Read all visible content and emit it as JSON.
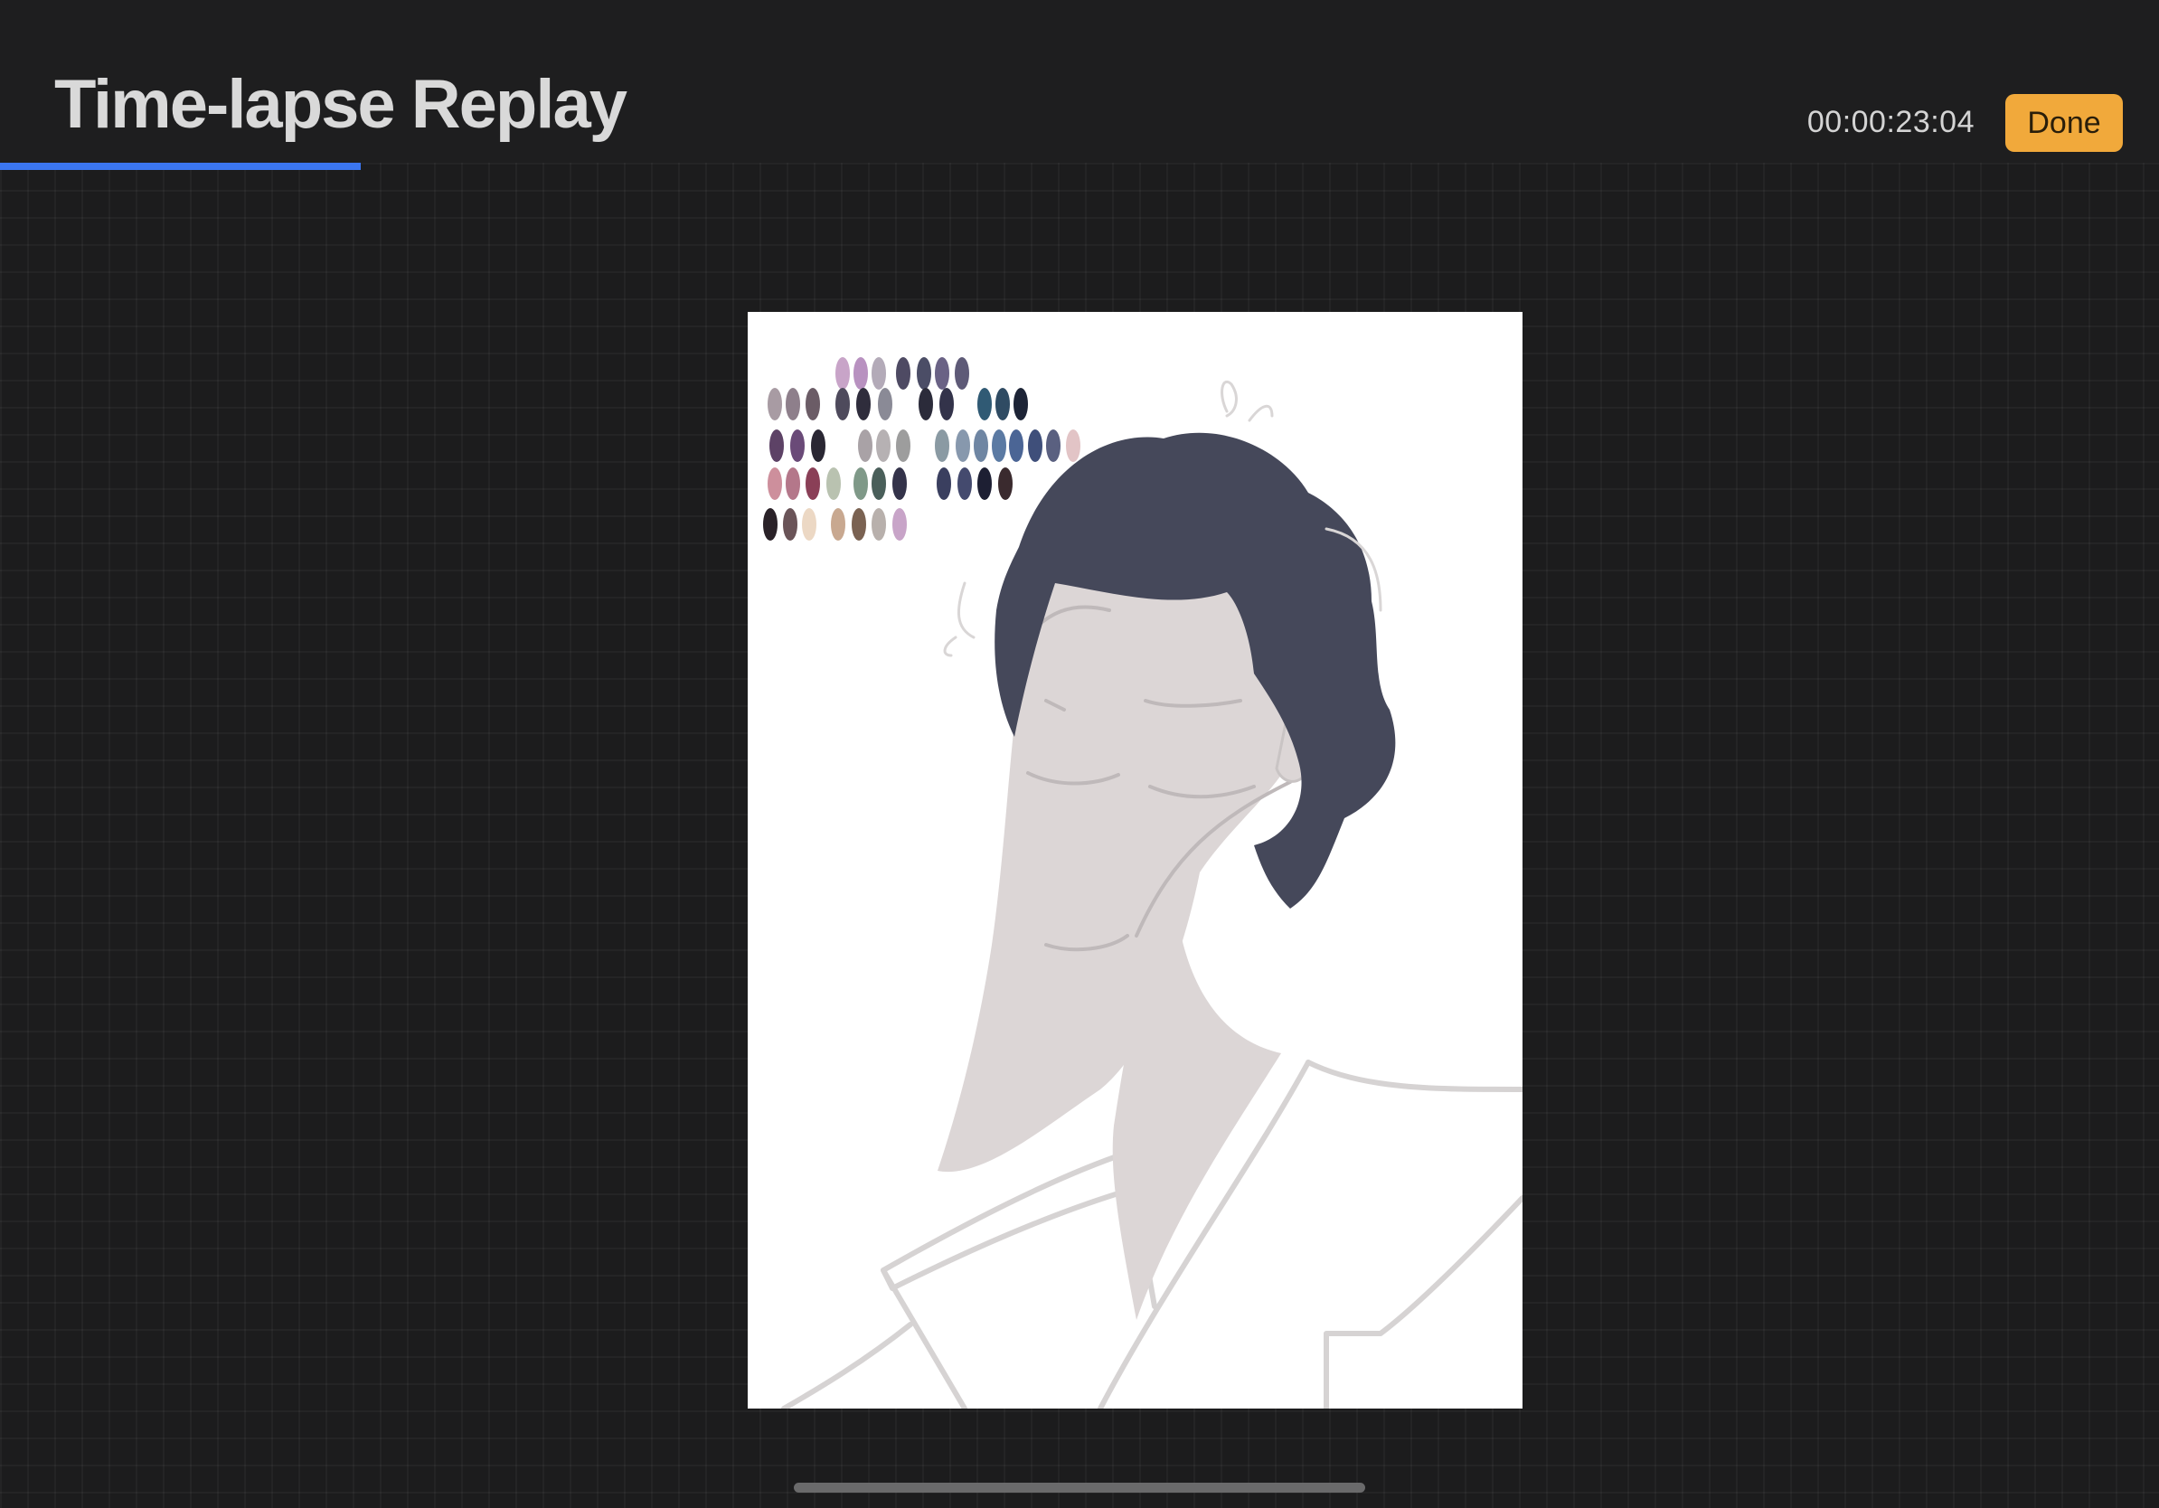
{
  "header": {
    "title": "Time-lapse Replay",
    "timecode": "00:00:23:04",
    "done_label": "Done"
  },
  "playback": {
    "progress_fraction": 0.167
  },
  "colors": {
    "accent_button": "#f1a93b",
    "progress": "#3b76f0",
    "hair": "#45485a",
    "skin": "#dcd6d6",
    "sketch_line": "#cfcccc"
  },
  "palette_swatches": [
    "#c8a4c8",
    "#b891c0",
    "#b3aab8",
    "#4e4a63",
    "#4b4d66",
    "#6a6285",
    "#5e5a77",
    "#a89ba3",
    "#8e7f8b",
    "#6b5c66",
    "#4e4a5c",
    "#2f2d3c",
    "#8a8a96",
    "#2b2b3a",
    "#33334a",
    "#305a74",
    "#2f4b63",
    "#1d2436",
    "#5d4266",
    "#6a4a78",
    "#2a2733",
    "#a9a2a6",
    "#b6b1b3",
    "#9d9d9d",
    "#8a9aa3",
    "#8798ad",
    "#6f86a3",
    "#5b7aa3",
    "#4b6595",
    "#3f4f7a",
    "#5a6080",
    "#e2c4c6",
    "#cd8f9c",
    "#b4778a",
    "#8a3f57",
    "#b9c2b0",
    "#7f9988",
    "#4a5f5a",
    "#34334a",
    "#3a3f5f",
    "#444a6e",
    "#1d1f33",
    "#3a2a2e",
    "#2a2228",
    "#6a5458",
    "#ecd8c4",
    "#c8a890",
    "#7a6252",
    "#b8b0ac"
  ]
}
